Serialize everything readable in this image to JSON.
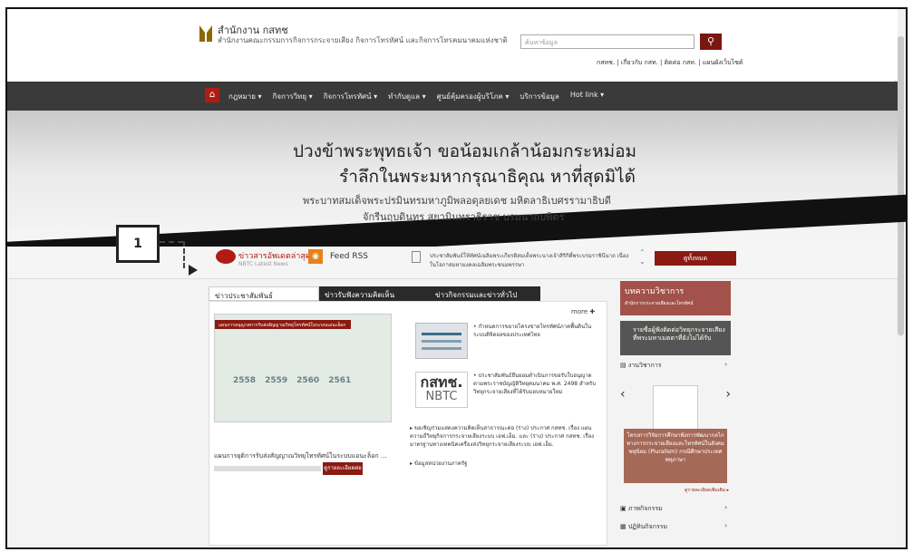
{
  "header": {
    "org_name": "สำนักงาน กสทช",
    "org_full_name": "สำนักงานคณะกรรมการกิจการกระจายเสียง กิจการโทรทัศน์ และกิจการโทรคมนาคมแห่งชาติ",
    "search_placeholder": "ค้นหาข้อมูล",
    "search_icon": "search-icon",
    "top_links": "กสทช. | เกี่ยวกับ กสท. | ติดต่อ กสท. | แผนผังเว็บไซต์"
  },
  "nav": {
    "home_icon": "home-icon",
    "items": [
      "กฎหมาย ▾",
      "กิจการวิทยุ ▾",
      "กิจการโทรทัศน์ ▾",
      "ทำกับดูแล ▾",
      "ศูนย์คุ้มครองผู้บริโภค ▾",
      "บริการข้อมูล",
      "Hot link ▾"
    ]
  },
  "banner": {
    "line1": "ปวงข้าพระพุทธเจ้า ขอน้อมเกล้าน้อมกระหม่อม",
    "line2": "รำลึกในพระมหากรุณาธิคุณ หาที่สุดมิได้",
    "line3": "พระบาทสมเด็จพระปรมินทรมหาภูมิพลอดุลยเดช มหิตลาธิเบศรรามาธิบดี",
    "line4": "จักรีนฤบดินทร สยามินทราธิราช บรมนาถบพิตร"
  },
  "newsbar": {
    "latest_title": "ข่าวสารอัพเดตล่าสุด",
    "latest_sub": "NBTC Latest News",
    "rss_label": "Feed RSS",
    "ticker_text": "ประชาสัมพันธ์ให้ทัศน์เฉลิมพระเกียรติสมเด็จพระนางเจ้าสิริกิติ์พระบรมราชินีนาถ เนื่องในโอกาสมหามงคลเฉลิมพระชนมพรรษา",
    "view_all": "ดูทั้งหมด"
  },
  "callout": {
    "number": "1"
  },
  "tabs": [
    {
      "label": "ข่าวประชาสัมพันธ์",
      "active": true
    },
    {
      "label": "ข่าวรับฟังความคิดเห็น",
      "active": false
    },
    {
      "label": "ข่าวกิจกรรมและข่าวทั่วไป",
      "active": false
    }
  ],
  "main": {
    "more": "more ✚",
    "diagram_title": "แผนการอนุญาตการรับส่งสัญญาณวิทยุโทรทัศน์ในระบบแอนะล็อก",
    "years": [
      "2558",
      "2559",
      "2560",
      "2561"
    ],
    "caption": "แผนการยุติการรับส่งสัญญาณวิทยุโทรทัศน์ในระบบแอนะล็อก ...",
    "read_more": "ดูรายละเอียดต่อ",
    "news1": "• กำหนดการขยายโครงข่ายโทรทัศน์ภาคพื้นดินในระบบดิจิตอลของประเทศไทย",
    "nbtc_thai": "กสทช.",
    "nbtc_en": "NBTC",
    "news2": "• ประชาสัมพันธ์ยืนยอมดำเนินการขอรับใบอนุญาตตามพระราชบัญญัติวิทยุคมนาคม พ.ศ. 2498 สำหรับวิทยุกระจายเสียงที่ได้รับมอบหมายใหม่",
    "news3": "▸ ขอเชิญร่วมแสดงความคิดเห็นสาธารณะต่อ (ร่าง) ประกาศ กสทช. เรื่อง แผนความถี่วิทยุกิจการกระจายเสียงระบบ เอฟ.เอ็ม. และ (ร่าง) ประกาศ กสทช. เรื่อง มาตรฐานทางเทคนิคเครื่องส่งวิทยุกระจายเสียงระบบ เอฟ.เอ็ม.",
    "news4": "▸ ข้อมูลหน่วยงานภาครัฐ"
  },
  "sidebar": {
    "article_title": "บทความวิชาการ",
    "article_sub": "สำนักการกระจายเสียงและโทรทัศน์",
    "image_text": "รายชื่อผู้ฟังติดต่อวิทยุกระจายเสียง ที่พระมหาเมตตาที่ยังไม่ได้รับ",
    "link_seminar": "งานวิชาการ",
    "book_caption": "โครงการวิจัยการศึกษาฟังการพัฒนากลไกทางการกระจายเสียงและโทรทัศน์ในสังคมพหุนิยม (Pluralism) กรณีศึกษาประเทศพหุภาษา",
    "book_more": "ดูรายละเอียดเพิ่มเติม ▸",
    "link_gallery": "ภาพกิจกรรม",
    "link_calendar": "ปฏิทินกิจกรรม"
  },
  "colors": {
    "accent": "#8b1a12",
    "nav": "#3a3a3a"
  }
}
